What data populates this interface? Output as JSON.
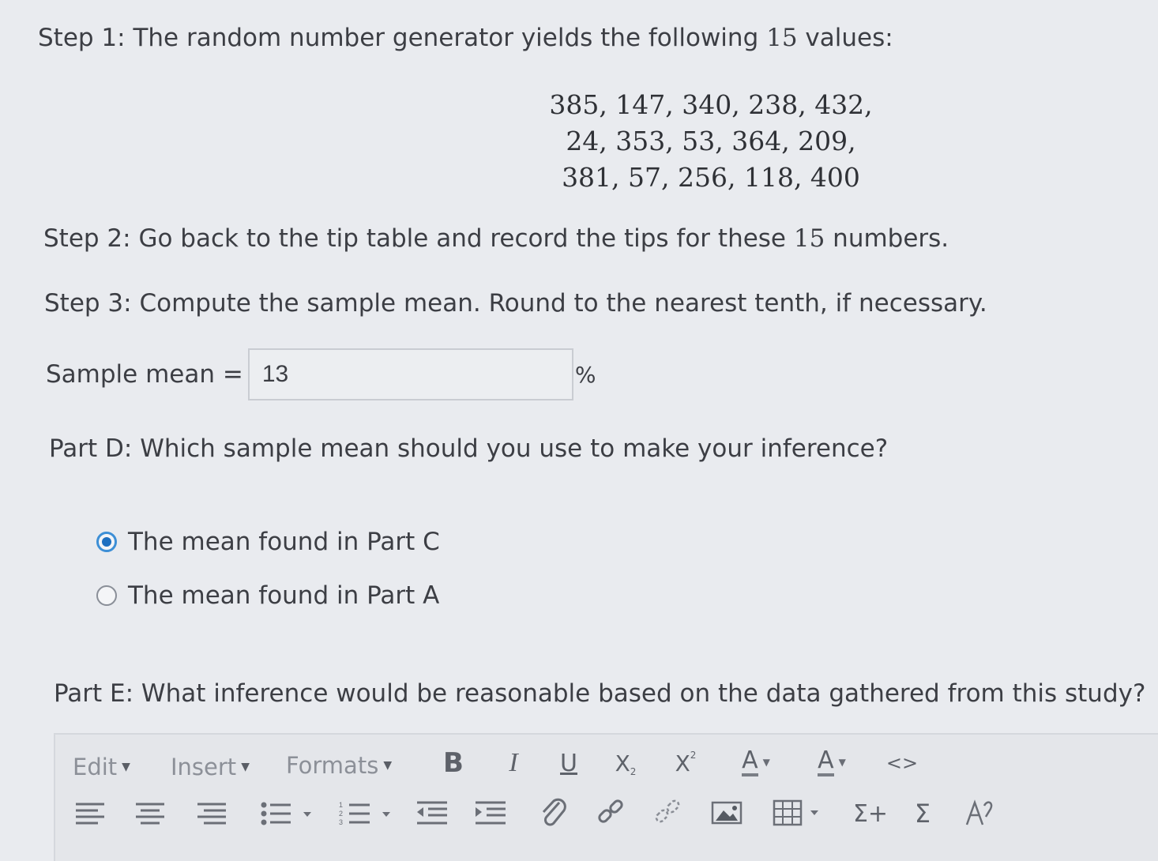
{
  "step1": {
    "prefix": "Step 1: The random number generator yields the following ",
    "count": "15",
    "suffix": " values:"
  },
  "values": {
    "line1": "385, 147, 340, 238, 432,",
    "line2": "24, 353, 53, 364, 209,",
    "line3": "381, 57, 256, 118, 400"
  },
  "step2": {
    "prefix": "Step 2: Go back to the tip table and record the tips for these ",
    "count": "15",
    "suffix": " numbers."
  },
  "step3": "Step 3: Compute the sample mean. Round to the nearest tenth, if necessary.",
  "sample_mean": {
    "label": "Sample mean =",
    "value": "13",
    "unit": "%"
  },
  "partD": {
    "question": "Part D: Which sample mean should you use to make your inference?",
    "options": [
      {
        "label": "The mean found in Part C",
        "selected": true
      },
      {
        "label": "The mean found in Part A",
        "selected": false
      }
    ]
  },
  "partE": {
    "question": "Part E: What inference would be reasonable based on the data gathered from this study?"
  },
  "toolbar": {
    "menus": [
      "Edit",
      "Insert",
      "Formats"
    ],
    "bold": "B",
    "italic": "I",
    "underline": "U",
    "subscript": "X",
    "superscript": "X",
    "font_color": "A",
    "bg_color": "A",
    "code": "<>",
    "sum_plus": "Σ+",
    "sum": "Σ"
  },
  "colors": {
    "radio_selected": "#1d6fc0",
    "background": "#e9ebef"
  }
}
